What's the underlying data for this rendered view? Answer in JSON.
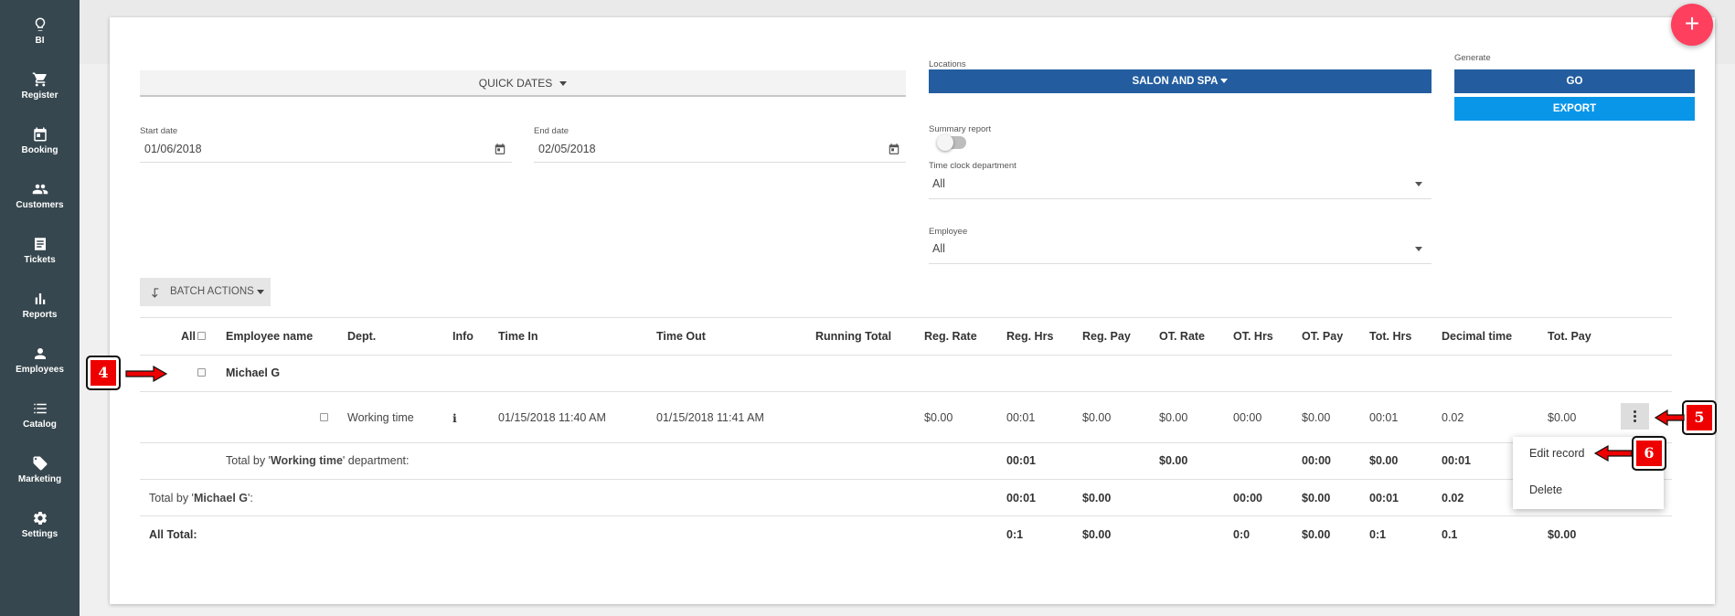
{
  "sidebar": {
    "items": [
      {
        "label": "BI",
        "icon": "lightbulb-icon"
      },
      {
        "label": "Register",
        "icon": "cart-icon"
      },
      {
        "label": "Booking",
        "icon": "calendar-icon"
      },
      {
        "label": "Customers",
        "icon": "people-icon"
      },
      {
        "label": "Tickets",
        "icon": "ticket-icon"
      },
      {
        "label": "Reports",
        "icon": "bar-chart-icon"
      },
      {
        "label": "Employees",
        "icon": "person-icon"
      },
      {
        "label": "Catalog",
        "icon": "list-icon"
      },
      {
        "label": "Marketing",
        "icon": "tag-icon"
      },
      {
        "label": "Settings",
        "icon": "gear-icon"
      }
    ]
  },
  "fab": {
    "label": "+"
  },
  "filters": {
    "quick_dates": "QUICK DATES",
    "start_date_label": "Start date",
    "start_date": "01/06/2018",
    "end_date_label": "End date",
    "end_date": "02/05/2018",
    "locations_label": "Locations",
    "location_value": "SALON AND SPA",
    "summary_label": "Summary report",
    "summary_on": false,
    "dept_label": "Time clock department",
    "dept_value": "All",
    "employee_label": "Employee",
    "employee_value": "All",
    "generate_label": "Generate",
    "go_label": "GO",
    "export_label": "EXPORT"
  },
  "batch": {
    "label": "BATCH ACTIONS"
  },
  "table": {
    "headers": {
      "all": "All",
      "employee": "Employee name",
      "dept": "Dept.",
      "info": "Info",
      "time_in": "Time In",
      "time_out": "Time Out",
      "running_total": "Running Total",
      "reg_rate": "Reg. Rate",
      "reg_hrs": "Reg. Hrs",
      "reg_pay": "Reg. Pay",
      "ot_rate": "OT. Rate",
      "ot_hrs": "OT. Hrs",
      "ot_pay": "OT. Pay",
      "tot_hrs": "Tot. Hrs",
      "decimal": "Decimal time",
      "tot_pay": "Tot. Pay"
    },
    "employee_name": "Michael G",
    "row": {
      "dept": "Working time",
      "info": "i",
      "time_in": "01/15/2018 11:40 AM",
      "time_out": "01/15/2018 11:41 AM",
      "reg_rate": "$0.00",
      "reg_hrs": "00:01",
      "reg_pay": "$0.00",
      "ot_rate": "$0.00",
      "ot_hrs": "00:00",
      "ot_pay": "$0.00",
      "tot_hrs": "00:01",
      "decimal": "0.02",
      "tot_pay": "$0.00"
    },
    "dept_total": {
      "prefix": "Total by '",
      "name": "Working time",
      "suffix": "' department:",
      "reg_hrs": "00:01",
      "ot_rate": "$0.00",
      "ot_pay": "00:00",
      "tot_hrs": "$0.00",
      "decimal": "00:01"
    },
    "emp_total": {
      "prefix": "Total by '",
      "name": "Michael G",
      "suffix": "':",
      "reg_hrs": "00:01",
      "reg_pay": "$0.00",
      "ot_hrs": "00:00",
      "ot_pay": "$0.00",
      "tot_hrs": "00:01",
      "decimal": "0.02"
    },
    "all_total": {
      "label": "All Total:",
      "reg_hrs": "0:1",
      "reg_pay": "$0.00",
      "ot_hrs": "0:0",
      "ot_pay": "$0.00",
      "tot_hrs": "0:1",
      "decimal": "0.1",
      "tot_pay": "$0.00"
    }
  },
  "row_menu": {
    "edit": "Edit record",
    "delete": "Delete"
  },
  "callouts": {
    "c4": "4",
    "c5": "5",
    "c6": "6"
  },
  "colors": {
    "sidebar": "#37474f",
    "primary": "#235d9f",
    "export": "#0a96e8",
    "fab": "#ff3f5e",
    "callout": "#e00000"
  }
}
